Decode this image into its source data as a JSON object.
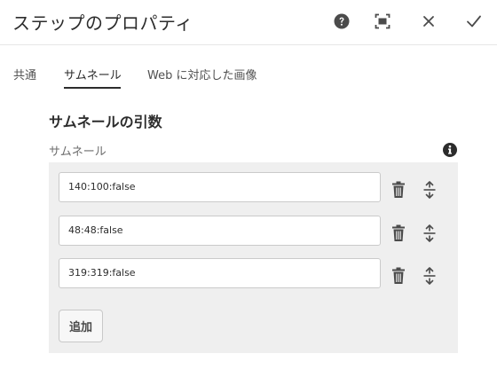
{
  "dialog": {
    "title": "ステップのプロパティ",
    "actions": [
      {
        "name": "help-icon"
      },
      {
        "name": "fullscreen-icon"
      },
      {
        "name": "close-icon"
      },
      {
        "name": "checkmark-icon"
      }
    ]
  },
  "tabs": [
    {
      "label": "共通",
      "active": false
    },
    {
      "label": "サムネール",
      "active": true
    },
    {
      "label": "Web に対応した画像",
      "active": false
    }
  ],
  "section": {
    "heading": "サムネールの引数",
    "field_label": "サムネール"
  },
  "multifield": {
    "items": [
      {
        "value": "140:100:false"
      },
      {
        "value": "48:48:false"
      },
      {
        "value": "319:319:false"
      }
    ],
    "add_label": "追加"
  },
  "colors": {
    "text": "#2c2c2c",
    "muted": "#6e6e6e",
    "panel_bg": "#efefef",
    "border": "#cacaca"
  }
}
